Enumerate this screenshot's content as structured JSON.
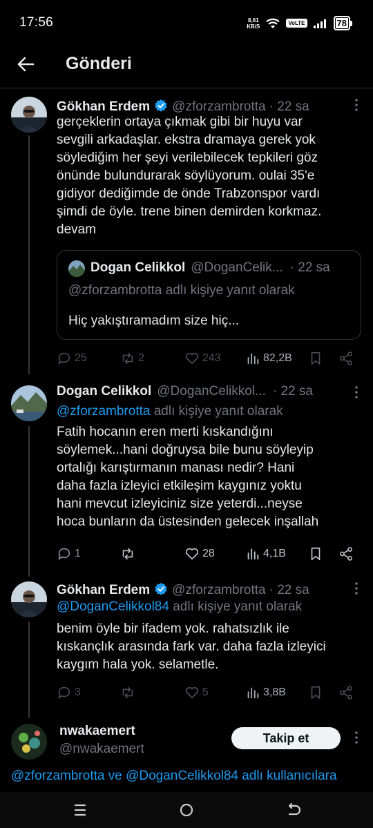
{
  "status_bar": {
    "time": "17:56",
    "net_speed_value": "8,61",
    "net_speed_unit": "KB/S",
    "volte": "VoLTE",
    "battery": "78"
  },
  "header": {
    "title": "Gönderi"
  },
  "posts": [
    {
      "name": "Gökhan Erdem",
      "handle": "@zforzambrotta",
      "time": "· 22 sa",
      "verified": true,
      "text": "gerçeklerin ortaya çıkmak gibi  bir huyu var\nsevgili arkadaşlar. ekstra dramaya gerek yok\nsöylediğim her şeyi verilebilecek tepkileri göz\nönünde bulundurarak söylüyorum. oulai 35'e\ngidiyor dediğimde de önde Trabzonspor vardı\nşimdi de öyle. trene binen demirden korkmaz.\ndevam",
      "quote": {
        "name": "Dogan Celikkol",
        "handle": "@DoganCelik...",
        "time": "· 22 sa",
        "reply_to": "@zforzambrotta adlı kişiye yanıt olarak",
        "text": "Hiç yakıştıramadım size hiç..."
      },
      "stats": {
        "replies": "25",
        "reposts": "2",
        "likes": "243",
        "views": "82,2B"
      }
    },
    {
      "name": "Dogan Celikkol",
      "handle": "@DoganCelikkol...",
      "time": "· 22 sa",
      "verified": false,
      "reply_mention": "@zforzambrotta",
      "reply_suffix": " adlı kişiye yanıt olarak",
      "text": "Fatih hocanın eren merti kıskandığını\nsöylemek...hani doğruysa bile bunu söyleyip\nortalığı karıştırmanın manası nedir? Hani\ndaha fazla izleyici etkileşim kaygınız yoktu\nhani mevcut izleyiciniz size yeterdi...neyse\nhoca bunların da üstesinden gelecek inşallah",
      "stats": {
        "replies": "1",
        "reposts": "",
        "likes": "28",
        "views": "4,1B"
      }
    },
    {
      "name": "Gökhan Erdem",
      "handle": "@zforzambrotta",
      "time": "· 22 sa",
      "verified": true,
      "reply_mention": "@DoganCelikkol84",
      "reply_suffix": " adlı kişiye yanıt olarak",
      "text": "benim öyle bir ifadem yok. rahatsızlık ile\nkıskançlık arasında fark var. daha fazla izleyici\nkaygım hala yok. selametle.",
      "stats": {
        "replies": "3",
        "reposts": "",
        "likes": "5",
        "views": "3,8B"
      }
    }
  ],
  "suggested": {
    "name": "nwakaemert",
    "handle": "@nwakaemert",
    "follow_label": "Takip et"
  },
  "mention_line": "@zforzambrotta ve @DoganCelikkol84 adlı kullanıcılara",
  "colors": {
    "background": "#000000",
    "text": "#e7e9ea",
    "muted": "#71767b",
    "accent": "#1d9bf0",
    "border": "#2f3336"
  }
}
